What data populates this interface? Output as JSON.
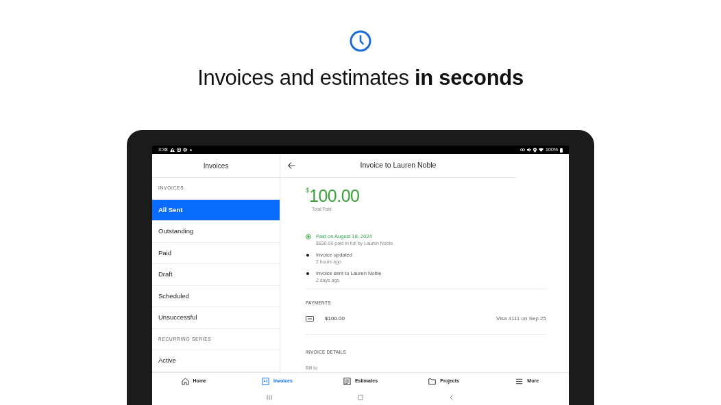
{
  "hero": {
    "title": "Invoices and estimates **in seconds**"
  },
  "status_bar": {
    "time": "3:38",
    "battery": "100%"
  },
  "sidebar": {
    "title": "Invoices",
    "sections": [
      {
        "heading": "INVOICES",
        "items": [
          {
            "label": "All Sent",
            "selected": true
          },
          {
            "label": "Outstanding",
            "selected": false
          },
          {
            "label": "Paid",
            "selected": false
          },
          {
            "label": "Draft",
            "selected": false
          },
          {
            "label": "Scheduled",
            "selected": false
          },
          {
            "label": "Unsuccessful",
            "selected": false
          }
        ]
      },
      {
        "heading": "RECURRING SERIES",
        "items": [
          {
            "label": "Active",
            "selected": false
          }
        ]
      }
    ]
  },
  "detail": {
    "title": "Invoice to Lauren Noble",
    "total": {
      "currency": "$",
      "amount": "100.00",
      "label": "Total Paid"
    },
    "timeline": [
      {
        "kind": "paid",
        "title": "Paid on August 18, 2024",
        "subtitle": "$830.00 paid in full by Lauren Noble"
      },
      {
        "kind": "event",
        "title": "Invoice updated",
        "subtitle": "2 hours ago"
      },
      {
        "kind": "event",
        "title": "Invoice sent to Lauren Noble",
        "subtitle": "2 days ago"
      }
    ],
    "payments": {
      "heading": "PAYMENTS",
      "rows": [
        {
          "amount": "$100.00",
          "method": "Visa 4111 on Sep 25"
        }
      ]
    },
    "invoice_details": {
      "heading": "INVOICE DETAILS",
      "fields": [
        {
          "label": "Bill to"
        }
      ]
    }
  },
  "bottom_nav": [
    {
      "label": "Home",
      "selected": false
    },
    {
      "label": "Invoices",
      "selected": true
    },
    {
      "label": "Estimates",
      "selected": false
    },
    {
      "label": "Projects",
      "selected": false
    },
    {
      "label": "More",
      "selected": false
    }
  ]
}
